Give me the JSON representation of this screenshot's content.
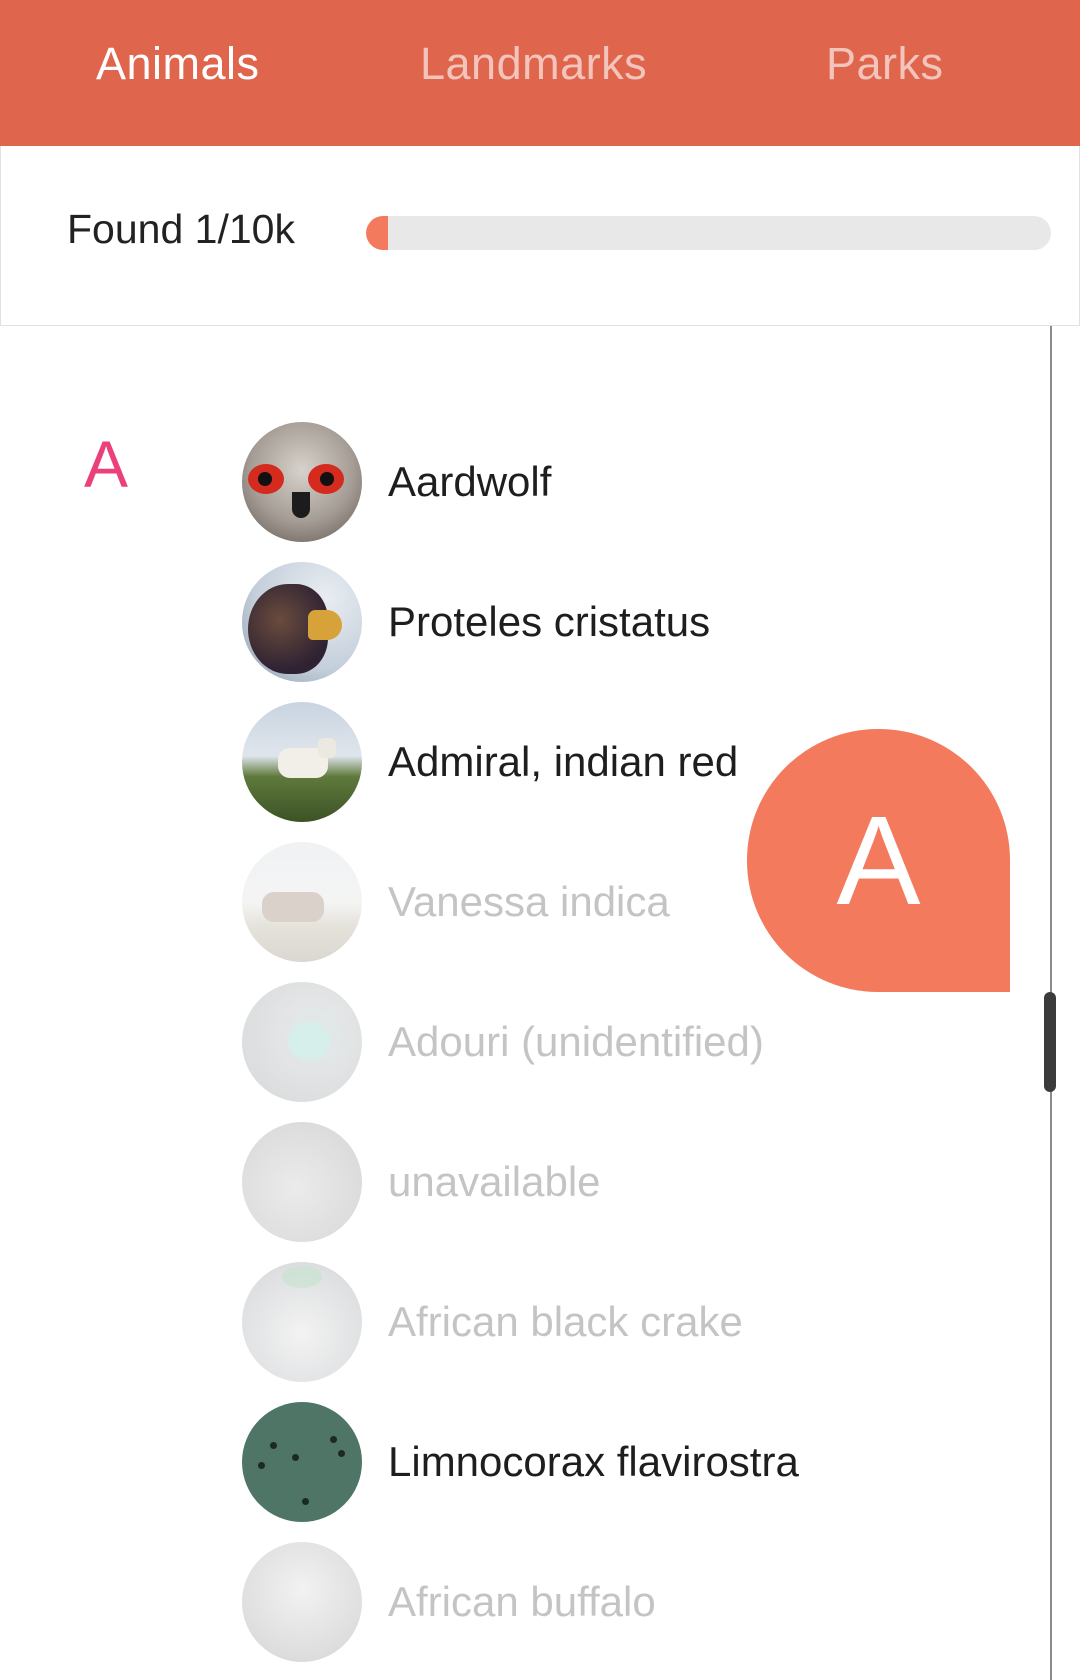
{
  "tabs": [
    {
      "label": "Animals",
      "active": true
    },
    {
      "label": "Landmarks",
      "active": false
    },
    {
      "label": "Parks",
      "active": false
    }
  ],
  "progress": {
    "label": "Found 1/10k",
    "found": 1,
    "total": 10000,
    "fraction": 0.0001
  },
  "list": {
    "section_letter": "A",
    "items": [
      {
        "label": "Aardwolf",
        "image": "owl-photo",
        "dimmed": false
      },
      {
        "label": "Proteles cristatus",
        "image": "eagle-photo",
        "dimmed": false
      },
      {
        "label": "Admiral, indian red",
        "image": "goat-photo",
        "dimmed": false
      },
      {
        "label": "Vanessa indica",
        "image": "antelope-photo",
        "dimmed": true
      },
      {
        "label": "Adouri (unidentified)",
        "image": "cat-eye-photo",
        "dimmed": true
      },
      {
        "label": "unavailable",
        "image": "kitten-photo",
        "dimmed": true
      },
      {
        "label": "African black crake",
        "image": "crake-photo",
        "dimmed": true
      },
      {
        "label": "Limnocorax flavirostra",
        "image": "birds-sky-photo",
        "dimmed": false
      },
      {
        "label": "African buffalo",
        "image": "buffalo-photo",
        "dimmed": true
      }
    ]
  },
  "fast_scroll": {
    "letter": "A"
  },
  "colors": {
    "tab_bar": "#DF654D",
    "accent": "#F47A5E",
    "section_letter": "#EC407A"
  }
}
